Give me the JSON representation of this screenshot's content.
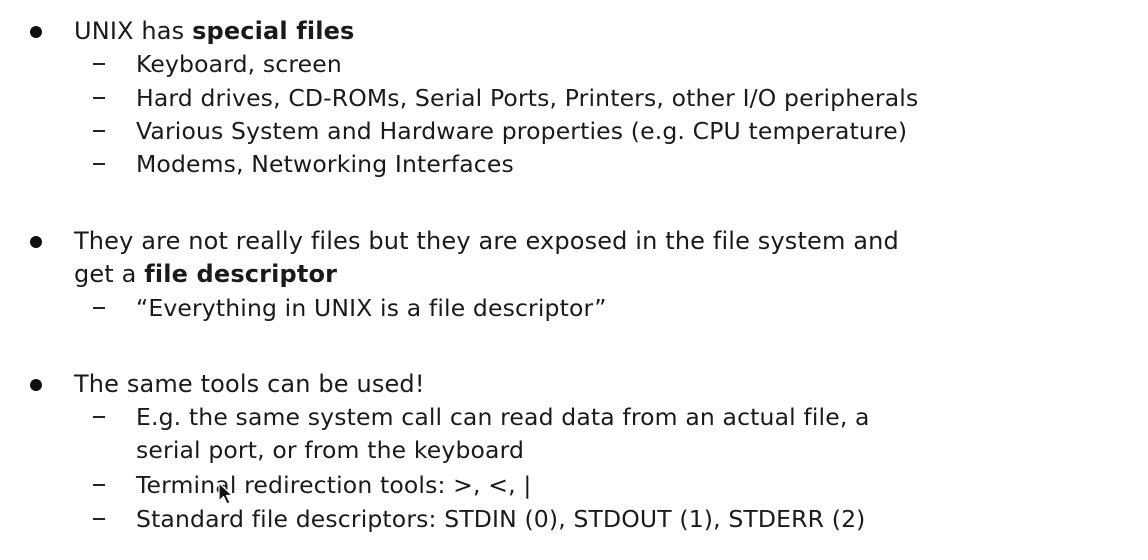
{
  "bullets": [
    {
      "lines": [
        {
          "parts": [
            "UNIX has ",
            "special files"
          ],
          "bold": [
            false,
            true
          ]
        }
      ],
      "subs": [
        [
          "Keyboard, screen"
        ],
        [
          "Hard drives, CD-ROMs, Serial Ports, Printers, other I/O peripherals"
        ],
        [
          "Various System and Hardware properties (e.g. CPU temperature)"
        ],
        [
          "Modems, Networking Interfaces"
        ]
      ]
    },
    {
      "lines": [
        {
          "parts": [
            "They are not really files but they are exposed in the file system and"
          ],
          "bold": [
            false
          ]
        },
        {
          "parts": [
            "get a ",
            "file descriptor"
          ],
          "bold": [
            false,
            true
          ]
        }
      ],
      "subs": [
        [
          "“Everything in UNIX is a file descriptor”"
        ]
      ]
    },
    {
      "lines": [
        {
          "parts": [
            "The same tools can be used!"
          ],
          "bold": [
            false
          ]
        }
      ],
      "subs": [
        [
          "E.g. the same system call can read data from an actual file, a",
          "serial port, or from the keyboard"
        ],
        [
          "Terminal redirection tools: >, <, |"
        ],
        [
          "Standard file descriptors: STDIN (0), STDOUT (1), STDERR (2)"
        ]
      ]
    }
  ],
  "colors": {
    "text": "#1a1a1a",
    "background": "#ffffff"
  },
  "icons": {
    "cursor": "mouse-pointer-icon"
  }
}
